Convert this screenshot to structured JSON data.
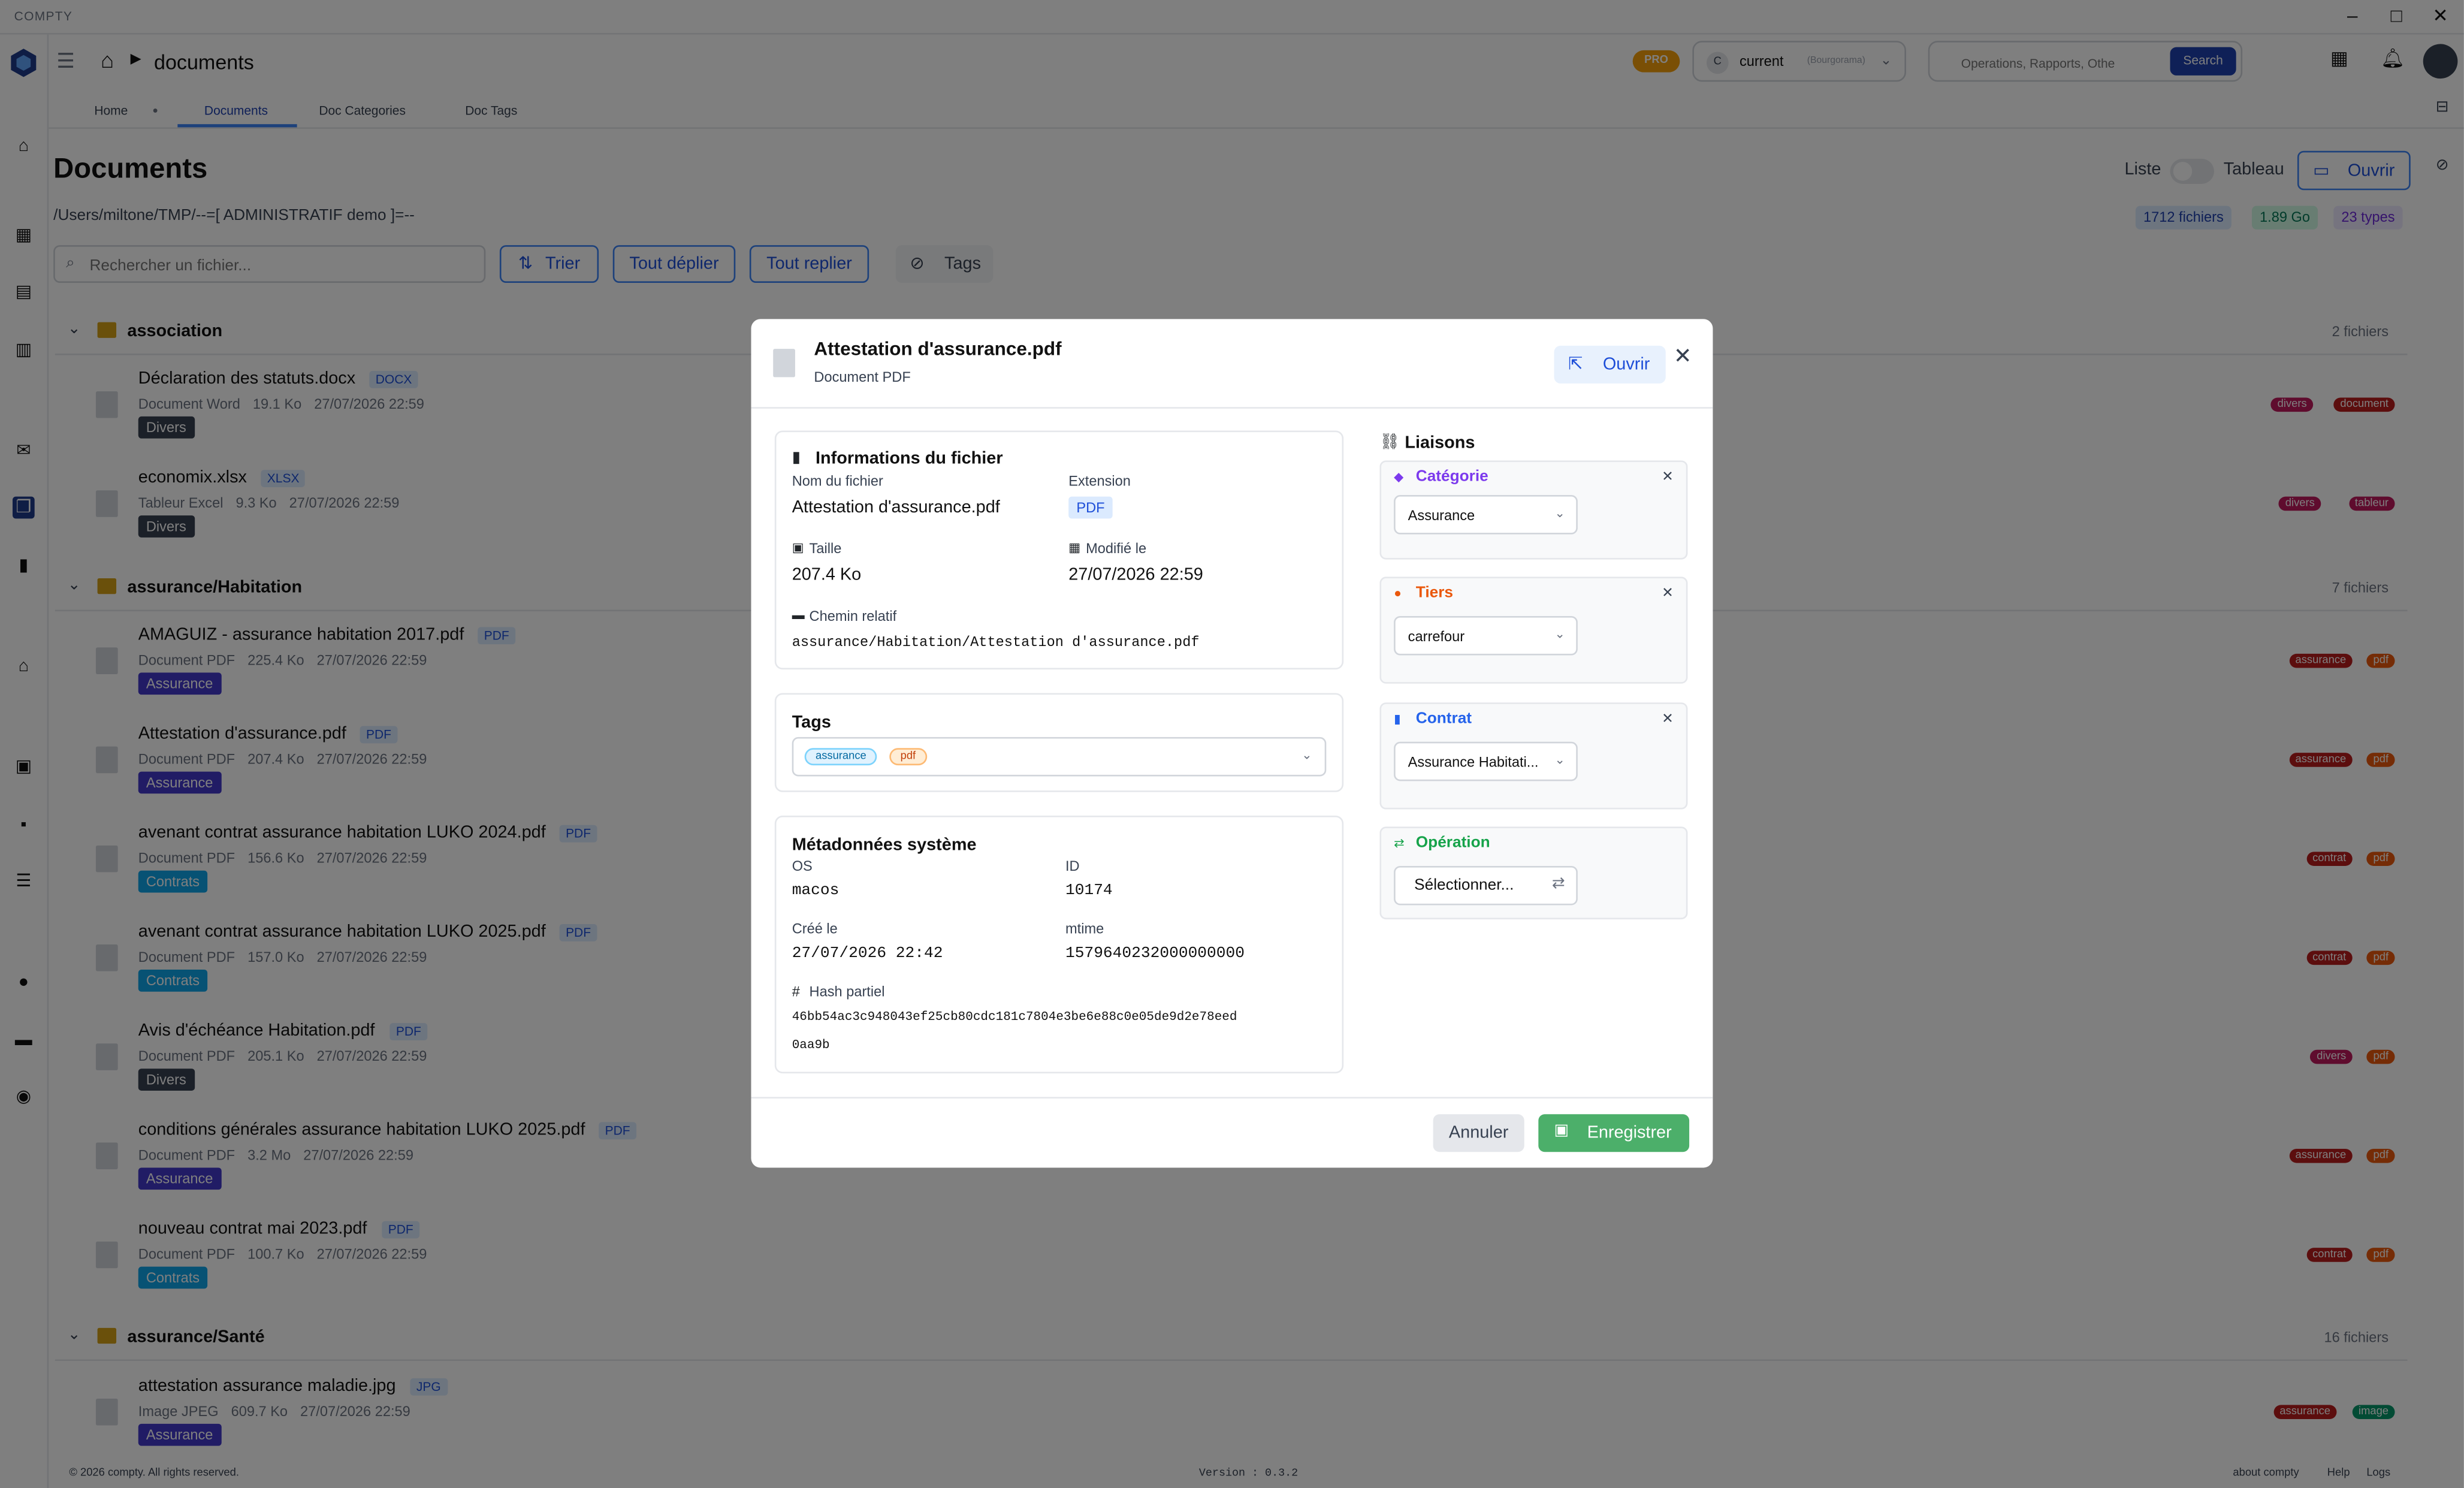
{
  "app": {
    "window_title": "COMPTY"
  },
  "header": {
    "breadcrumb": "documents",
    "pro_badge": "PRO",
    "company": {
      "avatar": "C",
      "name": "current",
      "sub": "(Bourgorama)"
    },
    "search_placeholder": "Operations, Rapports, Othe",
    "search_button": "Search"
  },
  "tabs": [
    "Home",
    "Documents",
    "Doc Categories",
    "Doc Tags"
  ],
  "page": {
    "title": "Documents",
    "path": "/Users/miltone/TMP/--=[ ADMINISTRATIF demo ]=--",
    "view_list": "Liste",
    "view_table": "Tableau",
    "open_button": "Ouvrir",
    "stats": {
      "files": "1712 fichiers",
      "size": "1.89 Go",
      "types": "23 types"
    },
    "file_search_placeholder": "Rechercher un fichier...",
    "toolbar": {
      "sort": "Trier",
      "expand_all": "Tout déplier",
      "collapse_all": "Tout replier",
      "tags": "Tags"
    }
  },
  "groups": [
    {
      "name": "association",
      "count": "2 fichiers"
    },
    {
      "name": "assurance/Habitation",
      "count": "7 fichiers"
    },
    {
      "name": "assurance/Santé",
      "count": "16 fichiers"
    }
  ],
  "files": [
    {
      "name": "Déclaration des statuts.docx",
      "ext": "DOCX",
      "type": "Document Word",
      "size": "19.1 Ko",
      "date": "27/07/2026 22:59",
      "category": "Divers",
      "tags": [
        "divers",
        "document"
      ]
    },
    {
      "name": "economix.xlsx",
      "ext": "XLSX",
      "type": "Tableur Excel",
      "size": "9.3 Ko",
      "date": "27/07/2026 22:59",
      "category": "Divers",
      "tags": [
        "divers",
        "tableur"
      ]
    },
    {
      "name": "AMAGUIZ - assurance habitation 2017.pdf",
      "ext": "PDF",
      "type": "Document PDF",
      "size": "225.4 Ko",
      "date": "27/07/2026 22:59",
      "category": "Assurance",
      "tags": [
        "assurance",
        "pdf"
      ]
    },
    {
      "name": "Attestation d'assurance.pdf",
      "ext": "PDF",
      "type": "Document PDF",
      "size": "207.4 Ko",
      "date": "27/07/2026 22:59",
      "category": "Assurance",
      "tags": [
        "assurance",
        "pdf"
      ]
    },
    {
      "name": "avenant contrat assurance habitation LUKO 2024.pdf",
      "ext": "PDF",
      "type": "Document PDF",
      "size": "156.6 Ko",
      "date": "27/07/2026 22:59",
      "category": "Contrats",
      "tags": [
        "contrat",
        "pdf"
      ]
    },
    {
      "name": "avenant contrat assurance habitation LUKO 2025.pdf",
      "ext": "PDF",
      "type": "Document PDF",
      "size": "157.0 Ko",
      "date": "27/07/2026 22:59",
      "category": "Contrats",
      "tags": [
        "contrat",
        "pdf"
      ]
    },
    {
      "name": "Avis d'échéance Habitation.pdf",
      "ext": "PDF",
      "type": "Document PDF",
      "size": "205.1 Ko",
      "date": "27/07/2026 22:59",
      "category": "Divers",
      "tags": [
        "divers",
        "pdf"
      ]
    },
    {
      "name": "conditions générales assurance habitation LUKO 2025.pdf",
      "ext": "PDF",
      "type": "Document PDF",
      "size": "3.2 Mo",
      "date": "27/07/2026 22:59",
      "category": "Assurance",
      "tags": [
        "assurance",
        "pdf"
      ]
    },
    {
      "name": "nouveau contrat mai 2023.pdf",
      "ext": "PDF",
      "type": "Document PDF",
      "size": "100.7 Ko",
      "date": "27/07/2026 22:59",
      "category": "Contrats",
      "tags": [
        "contrat",
        "pdf"
      ]
    },
    {
      "name": "attestation assurance maladie.jpg",
      "ext": "JPG",
      "type": "Image JPEG",
      "size": "609.7 Ko",
      "date": "27/07/2026 22:59",
      "category": "Assurance",
      "tags": [
        "assurance",
        "image"
      ]
    }
  ],
  "colors": {
    "Divers": "#374151",
    "Assurance": "#4338ca",
    "Contrats": "#0ea5e9",
    "divers": "#be185d",
    "document": "#b91c1c",
    "tableur": "#be185d",
    "assurance": "#b91c1c",
    "pdf": "#ea580c",
    "contrat": "#b91c1c",
    "image": "#059669"
  },
  "modal": {
    "title": "Attestation d'assurance.pdf",
    "subtitle": "Document PDF",
    "open_button": "Ouvrir",
    "info": {
      "section": "Informations du fichier",
      "name_label": "Nom du fichier",
      "name": "Attestation d'assurance.pdf",
      "ext_label": "Extension",
      "ext": "PDF",
      "size_label": "Taille",
      "size": "207.4 Ko",
      "modified_label": "Modifié le",
      "modified": "27/07/2026 22:59",
      "path_label": "Chemin relatif",
      "path": "assurance/Habitation/Attestation d'assurance.pdf"
    },
    "tags": {
      "section": "Tags",
      "values": [
        "assurance",
        "pdf"
      ]
    },
    "system": {
      "section": "Métadonnées système",
      "os_label": "OS",
      "os": "macos",
      "id_label": "ID",
      "id": "10174",
      "created_label": "Créé le",
      "created": "27/07/2026 22:42",
      "mtime_label": "mtime",
      "mtime": "1579640232000000000",
      "hash_label": "Hash partiel",
      "hash_line1": "46bb54ac3c948043ef25cb80cdc181c7804e3be6e88c0e05de9d2e78eed",
      "hash_line2": "0aa9b"
    },
    "links": {
      "section": "Liaisons",
      "categorie_label": "Catégorie",
      "categorie": "Assurance",
      "tiers_label": "Tiers",
      "tiers": "carrefour",
      "contrat_label": "Contrat",
      "contrat": "Assurance Habitati...",
      "operation_label": "Opération",
      "operation": "Sélectionner..."
    },
    "cancel": "Annuler",
    "save": "Enregistrer"
  },
  "footer": {
    "copyright": "© 2026 compty. All rights reserved.",
    "version": "Version : 0.3.2",
    "about": "about compty",
    "help": "Help",
    "logs": "Logs"
  }
}
